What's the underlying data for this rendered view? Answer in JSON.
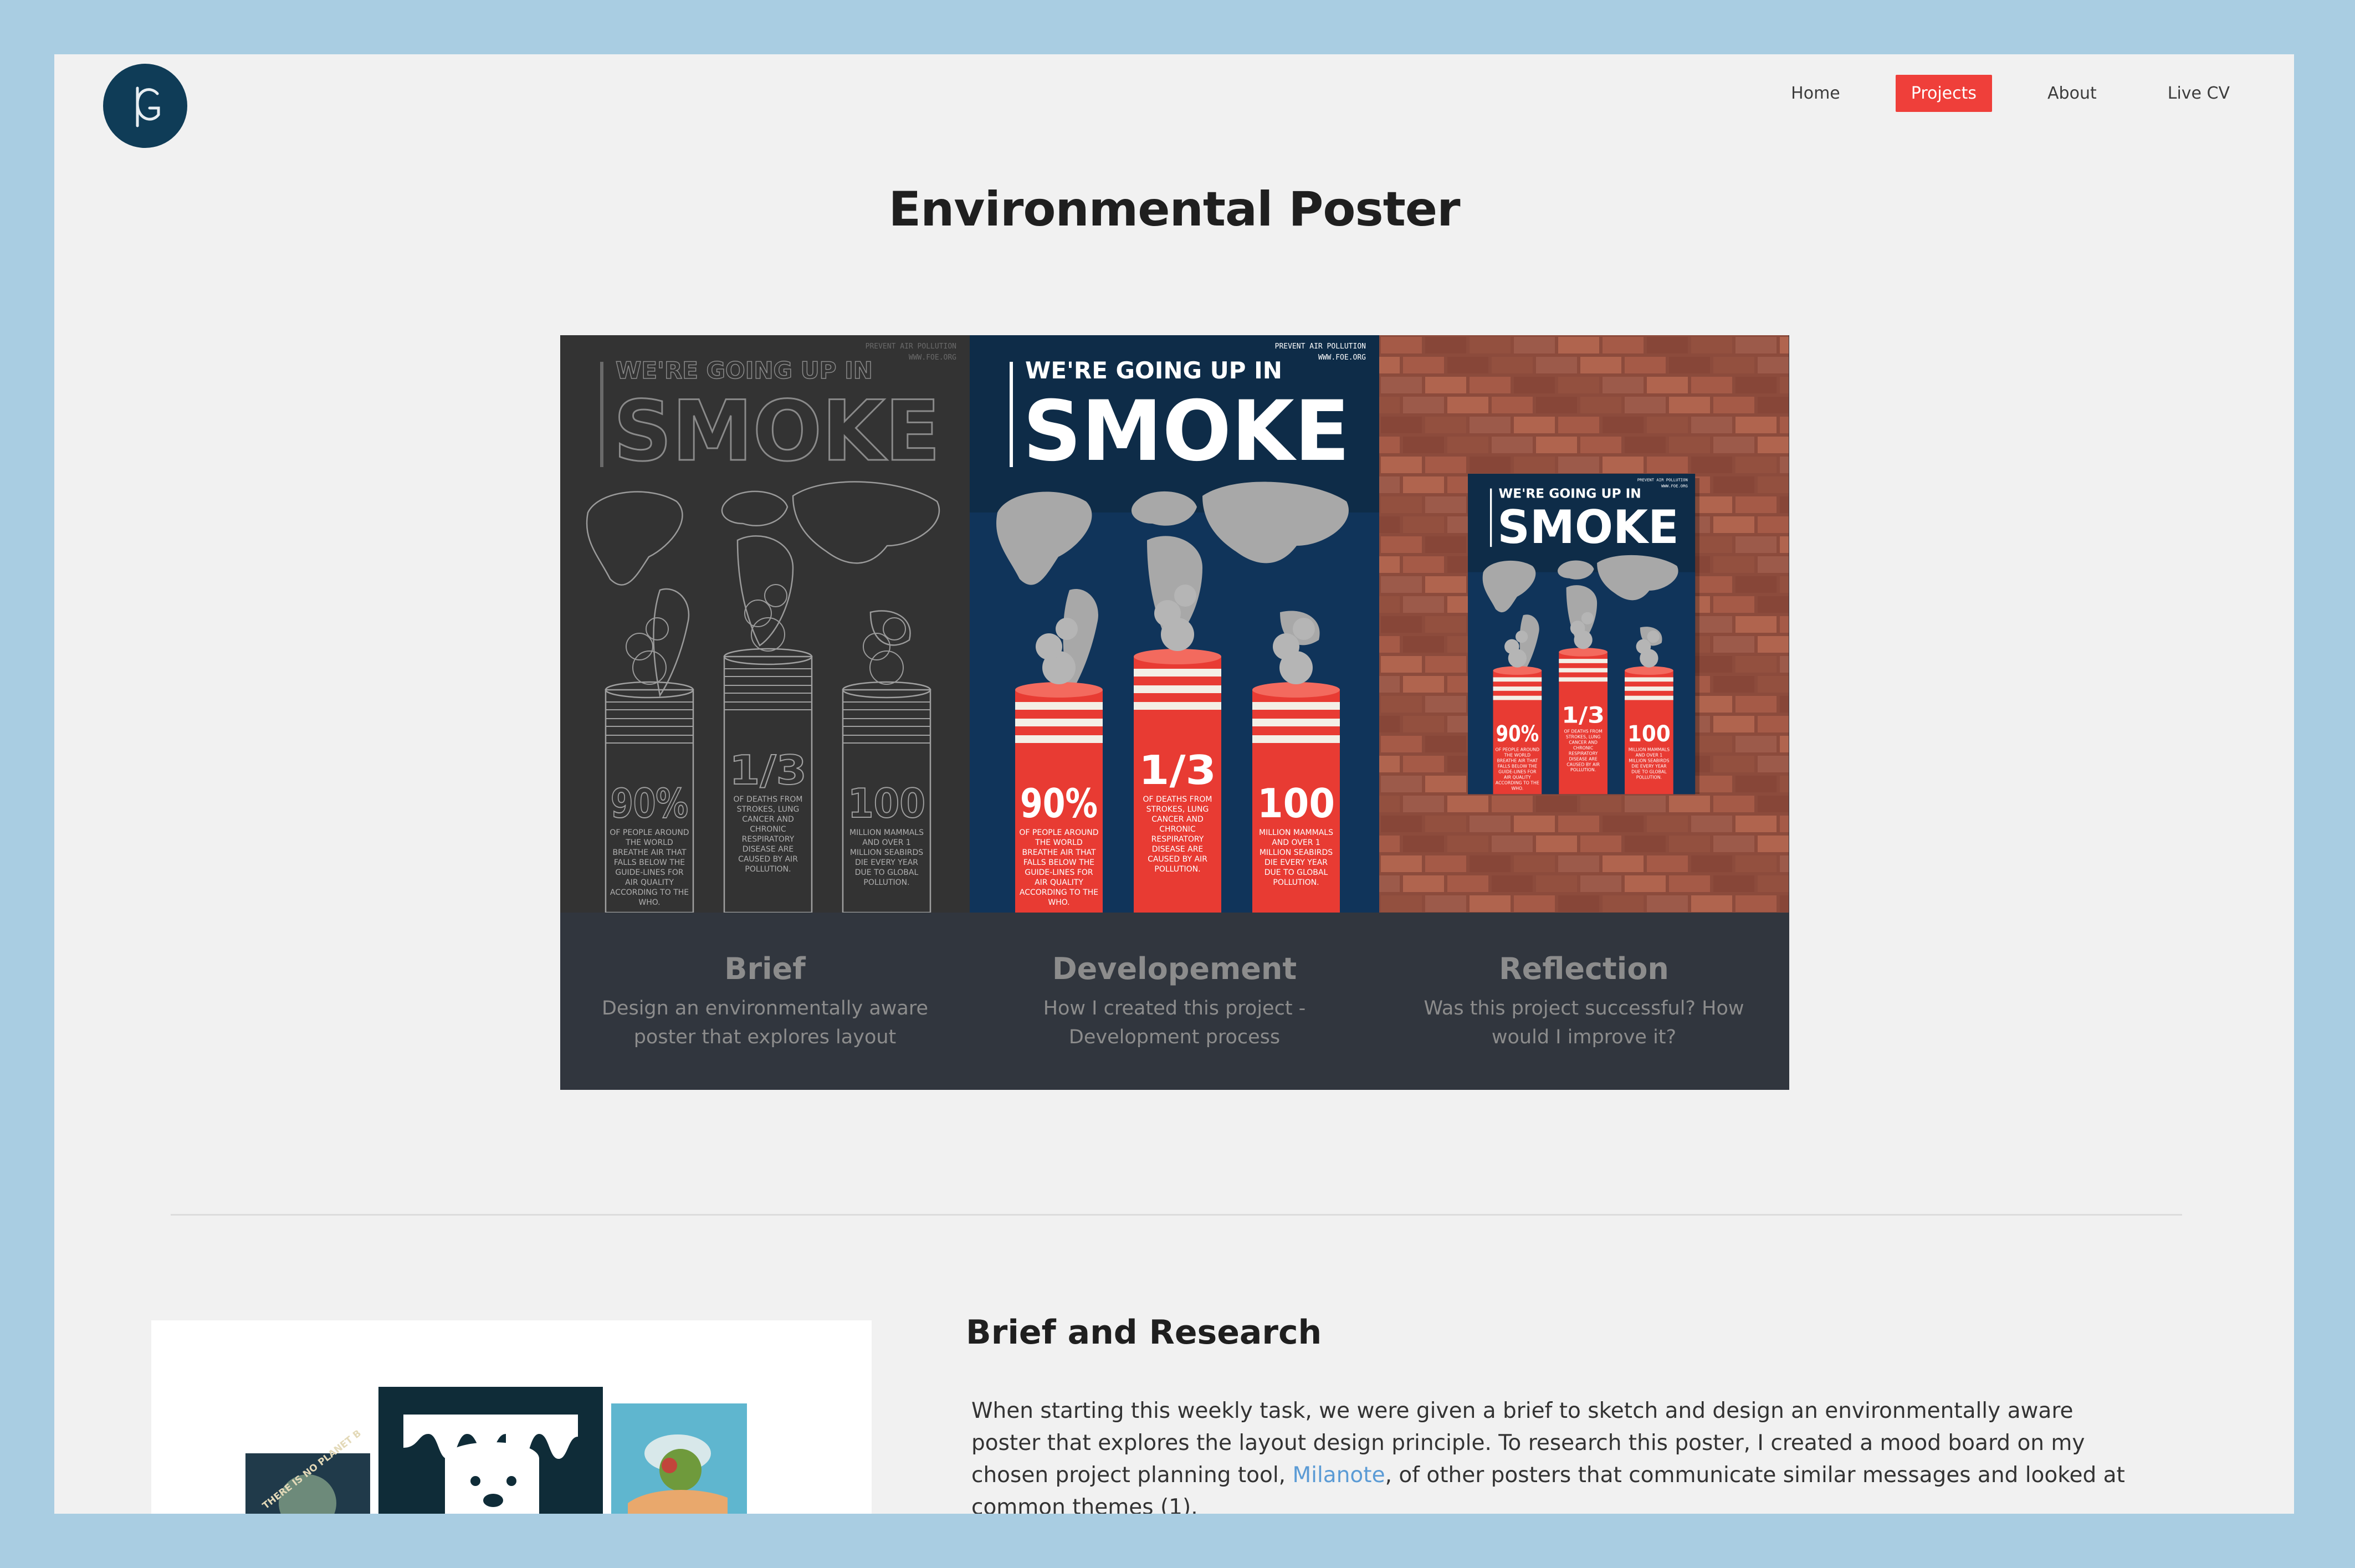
{
  "brand": {
    "logo_initials": "KG",
    "logo_color": "#0f3c57"
  },
  "nav": {
    "items": [
      {
        "label": "Home",
        "active": false
      },
      {
        "label": "Projects",
        "active": true
      },
      {
        "label": "About",
        "active": false
      },
      {
        "label": "Live CV",
        "active": false
      }
    ],
    "active_color": "#ef3f3a"
  },
  "page": {
    "title": "Environmental Poster"
  },
  "posters": {
    "header_small_1": "PREVENT AIR POLLUTION",
    "header_small_2": "WWW.FOE.ORG",
    "headline_small": "WE'RE GOING UP IN",
    "headline_big": "SMOKE",
    "stats": [
      {
        "value": "90%",
        "caption": "OF PEOPLE AROUND THE WORLD BREATHE AIR THAT FALLS BELOW THE GUIDE-LINES FOR AIR QUALITY ACCORDING TO THE WHO."
      },
      {
        "value": "1/3",
        "caption": "OF DEATHS FROM STROKES, LUNG CANCER AND CHRONIC RESPIRATORY DISEASE ARE CAUSED BY AIR POLLUTION."
      },
      {
        "value": "100",
        "caption": "MILLION MAMMALS AND OVER 1 MILLION SEABIRDS DIE EVERY YEAR DUE TO GLOBAL POLLUTION."
      }
    ]
  },
  "cards": [
    {
      "title": "Brief",
      "description": "Design an environmentally aware poster that explores layout"
    },
    {
      "title": "Developement",
      "description": "How I created this project - Development process"
    },
    {
      "title": "Reflection",
      "description": "Was this project successful? How would I improve it?"
    }
  ],
  "moodboard": {
    "sticker_text": "THERE IS NO PLANET B"
  },
  "section": {
    "title": "Brief and Research",
    "body_before_link": "When starting this weekly task, we were given a brief to sketch and design an environmentally aware poster that explores the layout design principle. To research this poster, I created a mood board on my chosen project planning tool, ",
    "link_text": "Milanote",
    "body_after_link": ", of other posters that communicate similar messages and looked at common themes (1)."
  }
}
